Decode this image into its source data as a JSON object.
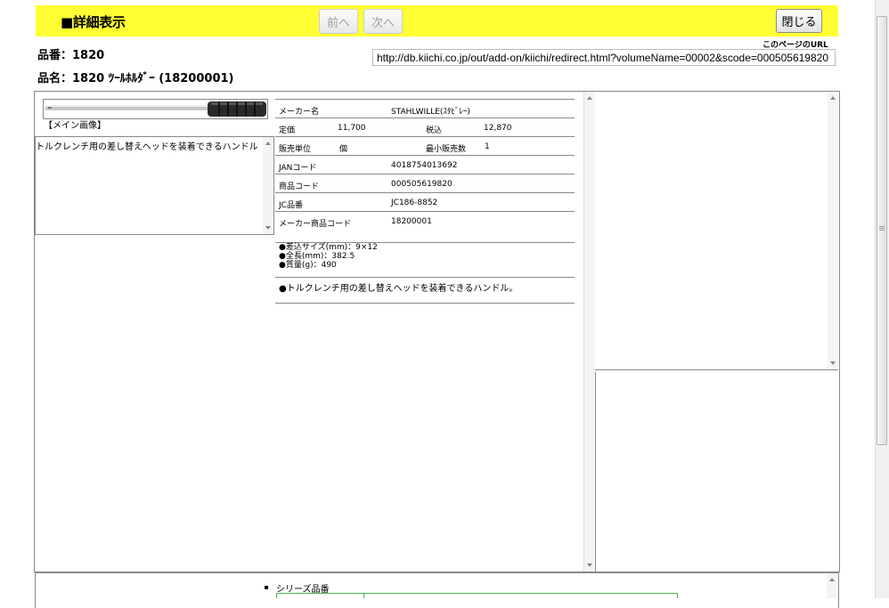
{
  "header": {
    "title": "■詳細表示",
    "prev_label": "前へ",
    "next_label": "次へ",
    "close_label": "閉じる"
  },
  "part": {
    "hinban": "品番：1820",
    "hinmei": "品名：1820 ﾂｰﾙﾎﾙﾀﾞｰ (18200001)"
  },
  "url": {
    "label": "このページのURL",
    "value": "http://db.kiichi.co.jp/out/add-on/kiichi/redirect.html?volumeName=00002&scode=000505619820"
  },
  "image": {
    "label": "【メイン画像】"
  },
  "description": "トルクレンチ用の差し替えヘッドを装着できるハンドル",
  "specs": {
    "maker_label": "メーカー名",
    "maker_value": "STAHLWILLE(ｽﾀﾋﾞﾚｰ)",
    "price_label": "定価",
    "price_value": "11,700",
    "tax_label": "税込",
    "tax_value": "12,870",
    "unit_label": "販売単位",
    "unit_value": "個",
    "min_label": "最小販売数",
    "min_value": "1",
    "jan_label": "JANコード",
    "jan_value": "4018754013692",
    "code_label": "商品コード",
    "code_value": "000505619820",
    "jc_label": "JC品番",
    "jc_value": "JC186-8852",
    "maker_code_label": "メーカー商品コード",
    "maker_code_value": "18200001"
  },
  "features": {
    "line1": "●差込サイズ(mm)：9×12",
    "line2": "●全長(mm)：382.5",
    "line3": "●質量(g)：490"
  },
  "note": "●トルクレンチ用の差し替えヘッドを装着できるハンドル。",
  "series": {
    "label": "シリーズ品番"
  },
  "colors": {
    "header_bg": "#ffff33",
    "border": "#888888",
    "series_border": "#4caf50"
  }
}
